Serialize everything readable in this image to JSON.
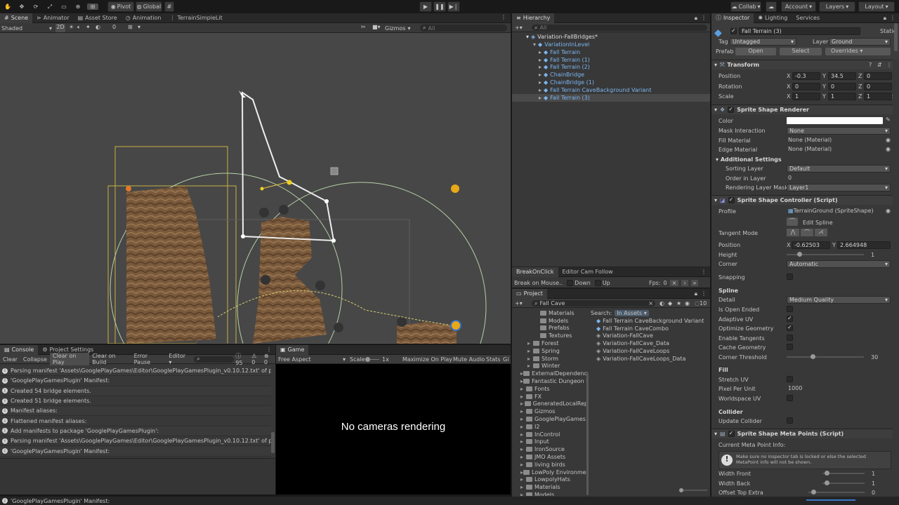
{
  "toolbar": {
    "pivot": "Pivot",
    "global": "Global",
    "collab": "Collab",
    "account": "Account",
    "layers": "Layers",
    "layout": "Layout"
  },
  "scene": {
    "tabs": [
      "Scene",
      "Animator",
      "Asset Store",
      "Animation",
      "TerrainSimpleLit"
    ],
    "shading": "Shaded",
    "mode_2d": "2D",
    "gizmos": "Gizmos",
    "search_placeholder": "All",
    "light_count": "0"
  },
  "hierarchy": {
    "title": "Hierarchy",
    "search_placeholder": "All",
    "root": "Variation-FallBridges*",
    "parent": "VariationInLevel",
    "children": [
      "Fall Terrain",
      "Fall Terrain (1)",
      "Fall Terrain (2)",
      "ChainBridge",
      "ChainBridge (1)",
      "Fall Terrain CaveBackground Variant",
      "Fall Terrain (3)"
    ]
  },
  "breakbar": {
    "tab1": "BreakOnClick",
    "tab2": "Editor Cam Follow",
    "break_label": "Break on Mouse..",
    "down": "Down",
    "up": "Up",
    "fps_label": "Fps:",
    "fps": "0"
  },
  "project": {
    "title": "Project",
    "search_value": "Fall Cave",
    "search_label": "Search:",
    "search_scope": "In Assets",
    "count": "10",
    "folders": [
      {
        "name": "Materials",
        "indent": 2
      },
      {
        "name": "Models",
        "indent": 2
      },
      {
        "name": "Prefabs",
        "indent": 2
      },
      {
        "name": "Textures",
        "indent": 2
      },
      {
        "name": "Forest",
        "indent": 1
      },
      {
        "name": "Spring",
        "indent": 1
      },
      {
        "name": "Storm",
        "indent": 1
      },
      {
        "name": "Winter",
        "indent": 1
      },
      {
        "name": "ExternalDependency",
        "indent": 0
      },
      {
        "name": "Fantastic Dungeon P",
        "indent": 0
      },
      {
        "name": "Fonts",
        "indent": 0
      },
      {
        "name": "FX",
        "indent": 0
      },
      {
        "name": "GeneratedLocalRep",
        "indent": 0
      },
      {
        "name": "Gizmos",
        "indent": 0
      },
      {
        "name": "GooglePlayGames",
        "indent": 0
      },
      {
        "name": "I2",
        "indent": 0
      },
      {
        "name": "InControl",
        "indent": 0
      },
      {
        "name": "Input",
        "indent": 0
      },
      {
        "name": "IronSource",
        "indent": 0
      },
      {
        "name": "JMO Assets",
        "indent": 0
      },
      {
        "name": "living birds",
        "indent": 0
      },
      {
        "name": "LowPoly Environmer",
        "indent": 0
      },
      {
        "name": "LowpolyHats",
        "indent": 0
      },
      {
        "name": "Materials",
        "indent": 0
      },
      {
        "name": "Models",
        "indent": 0
      }
    ],
    "results": [
      "Fall Terrain CaveBackground Variant",
      "Fall Terrain CaveCombo",
      "Variation-FallCave",
      "Variation-FallCave_Data",
      "Variation-FallCaveLoops",
      "Variation-FallCaveLoops_Data"
    ]
  },
  "console": {
    "tabs": [
      "Console",
      "Project Settings"
    ],
    "buttons": [
      "Clear",
      "Collapse",
      "Clear on Play",
      "Clear on Build",
      "Error Pause",
      "Editor"
    ],
    "info_count": "95",
    "warn_count": "0",
    "error_count": "0",
    "rows": [
      "Parsing manifest 'Assets\\GooglePlayGames\\Editor\\GooglePlayGamesPlugin_v0.10.12.txt' of package 'G",
      "'GooglePlayGamesPlugin' Manifest:",
      "Created 54 bridge elements.",
      "Created 51 bridge elements.",
      "Manifest aliases:",
      "Flattened manifest aliases:",
      "Add manifests to package 'GooglePlayGamesPlugin':",
      "Parsing manifest 'Assets\\GooglePlayGames\\Editor\\GooglePlayGamesPlugin_v0.10.12.txt' of package 'G",
      "'GooglePlayGamesPlugin' Manifest:"
    ]
  },
  "game": {
    "tab": "Game",
    "aspect": "Free Aspect",
    "scale_label": "Scale",
    "scale_value": "1x",
    "maximize": "Maximize On Play",
    "mute": "Mute Audio",
    "stats": "Stats",
    "gizmos": "Gi",
    "message": "No cameras rendering"
  },
  "inspector": {
    "tabs": [
      "Inspector",
      "Lighting",
      "Services"
    ],
    "object_name": "Fall Terrain (3)",
    "static": "Static",
    "tag_label": "Tag",
    "tag": "Untagged",
    "layer_label": "Layer",
    "layer": "Ground",
    "prefab_label": "Prefab",
    "open": "Open",
    "select": "Select",
    "overrides": "Overrides",
    "transform": {
      "title": "Transform",
      "position_label": "Position",
      "rotation_label": "Rotation",
      "scale_label": "Scale",
      "position": [
        "-0.3",
        "34.5",
        "0"
      ],
      "rotation": [
        "0",
        "0",
        "0"
      ],
      "scale": [
        "1",
        "1",
        "1"
      ]
    },
    "renderer": {
      "title": "Sprite Shape Renderer",
      "color_label": "Color",
      "color": "#ffffff",
      "mask_label": "Mask Interaction",
      "mask": "None",
      "fill_mat_label": "Fill Material",
      "fill_mat": "None (Material)",
      "edge_mat_label": "Edge Material",
      "edge_mat": "None (Material)",
      "additional": "Additional Settings",
      "sorting_label": "Sorting Layer",
      "sorting": "Default",
      "order_label": "Order in Layer",
      "order": "0",
      "rlm_label": "Rendering Layer Mask",
      "rlm": "Layer1"
    },
    "controller": {
      "title": "Sprite Shape Controller (Script)",
      "profile_label": "Profile",
      "profile": "TerrainGround (SpriteShape)",
      "edit_spline": "Edit Spline",
      "tangent_label": "Tangent Mode",
      "position_label": "Position",
      "pos_x": "-0.62503",
      "pos_y": "2.664948",
      "height_label": "Height",
      "height": "1",
      "height_fraction": 0.15,
      "corner_label": "Corner",
      "corner": "Automatic",
      "snapping_label": "Snapping",
      "spline_header": "Spline",
      "detail_label": "Detail",
      "detail": "Medium Quality",
      "open_ended_label": "Is Open Ended",
      "adaptive_label": "Adaptive UV",
      "optimize_label": "Optimize Geometry",
      "tangents_label": "Enable Tangents",
      "cache_label": "Cache Geometry",
      "corner_threshold_label": "Corner Threshold",
      "corner_threshold": "30",
      "corner_threshold_fraction": 0.33,
      "fill_header": "Fill",
      "stretch_label": "Stretch UV",
      "ppu_label": "Pixel Per Unit",
      "ppu": "1000",
      "worldspace_label": "Worldspace UV",
      "collider_header": "Collider",
      "update_collider_label": "Update Collider"
    },
    "meta": {
      "title": "Sprite Shape Meta Points (Script)",
      "current_label": "Current Meta Point Info:",
      "help": "Make sure no inspector tab is locked or else the selected MetaPoint info will not be shown.",
      "width_front_label": "Width Front",
      "width_front": "1",
      "width_back_label": "Width Back",
      "width_back": "1",
      "offset_label": "Offset Top Extra",
      "offset": "0"
    }
  },
  "status": {
    "message": "'GooglePlayGamesPlugin' Manifest:"
  }
}
